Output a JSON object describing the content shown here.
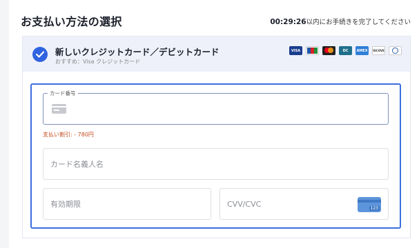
{
  "header": {
    "title": "お支払い方法の選択",
    "timer_value": "00:29:26",
    "timer_suffix": "以内にお手続きを完了してください"
  },
  "payment_method": {
    "title": "新しいクレジットカード／デビットカード",
    "subtitle": "おすすめ：Visa クレジットカード",
    "selected": true,
    "brands": [
      "VISA",
      "JCB",
      "Mastercard",
      "Diners Club",
      "AMEX",
      "DISCOVER",
      "Diners"
    ]
  },
  "form": {
    "card_number_label": "カード番号",
    "card_number_value": "",
    "discount_text": "支払い割引: - 780円",
    "holder_placeholder": "カード名義人名",
    "expiry_placeholder": "有効期限",
    "cvv_placeholder": "CVV/CVC",
    "cvv_icon_number": "123"
  },
  "colors": {
    "accent": "#3b6fe0",
    "check": "#2f63e0",
    "discount": "#c44a1c",
    "selected_bg": "#eef1fa"
  }
}
